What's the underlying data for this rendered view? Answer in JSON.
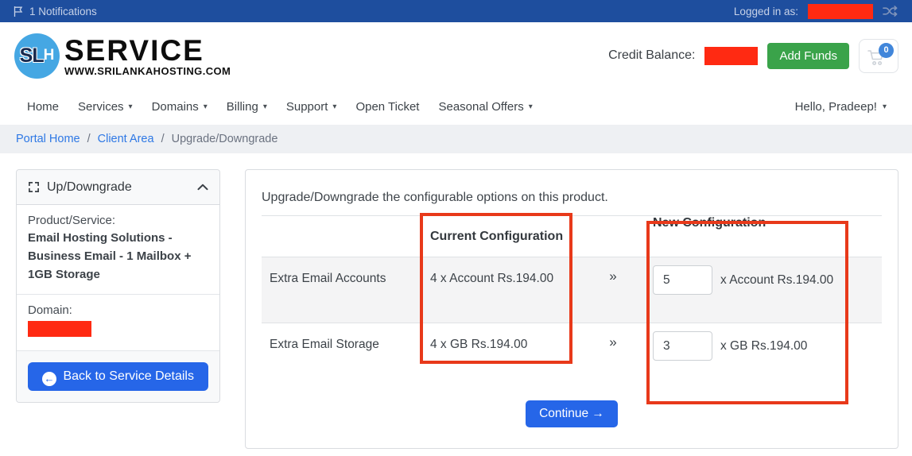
{
  "topbar": {
    "notifications_label": "1 Notifications",
    "logged_in_label": "Logged in as:"
  },
  "header": {
    "logo_badge_main": "SL",
    "logo_badge_sub": "H",
    "logo_title": "SERVICE",
    "logo_subtitle": "WWW.SRILANKAHOSTING.COM",
    "credit_balance_label": "Credit Balance:",
    "add_funds_label": "Add Funds",
    "cart_count": "0"
  },
  "nav": {
    "items": [
      {
        "label": "Home",
        "has_dropdown": false
      },
      {
        "label": "Services",
        "has_dropdown": true
      },
      {
        "label": "Domains",
        "has_dropdown": true
      },
      {
        "label": "Billing",
        "has_dropdown": true
      },
      {
        "label": "Support",
        "has_dropdown": true
      },
      {
        "label": "Open Ticket",
        "has_dropdown": false
      },
      {
        "label": "Seasonal Offers",
        "has_dropdown": true
      }
    ],
    "greeting": "Hello, Pradeep!"
  },
  "breadcrumb": {
    "items": [
      "Portal Home",
      "Client Area",
      "Upgrade/Downgrade"
    ],
    "separator": "/"
  },
  "sidebar": {
    "title": "Up/Downgrade",
    "product_label": "Product/Service:",
    "product_name": "Email Hosting Solutions - Business Email - 1 Mailbox + 1GB Storage",
    "domain_label": "Domain:",
    "back_button_label": "Back to Service Details"
  },
  "main": {
    "intro": "Upgrade/Downgrade the configurable options on this product.",
    "current_column_header": "Current Configuration",
    "new_column_header": "New Configuration",
    "rows": [
      {
        "option": "Extra Email Accounts",
        "current": "4 x Account Rs.194.00",
        "new_quantity": "5",
        "new_unit": "x Account Rs.194.00"
      },
      {
        "option": "Extra Email Storage",
        "current": "4 x GB Rs.194.00",
        "new_quantity": "3",
        "new_unit": "x GB Rs.194.00"
      }
    ],
    "continue_label": "Continue"
  },
  "icons": {
    "caret_down": "▾",
    "double_angle": "»",
    "arrow_left": "←",
    "arrow_right": "→"
  },
  "colors": {
    "topbar_blue": "#1e4e9e",
    "link_blue": "#2e78e5",
    "primary_button_blue": "#2666e8",
    "add_funds_green": "#3aa34a",
    "redaction_red": "#ff2a12",
    "annotation_red": "#e8391a",
    "cart_badge_blue": "#4186da",
    "logo_circle_blue": "#45a7e3"
  }
}
